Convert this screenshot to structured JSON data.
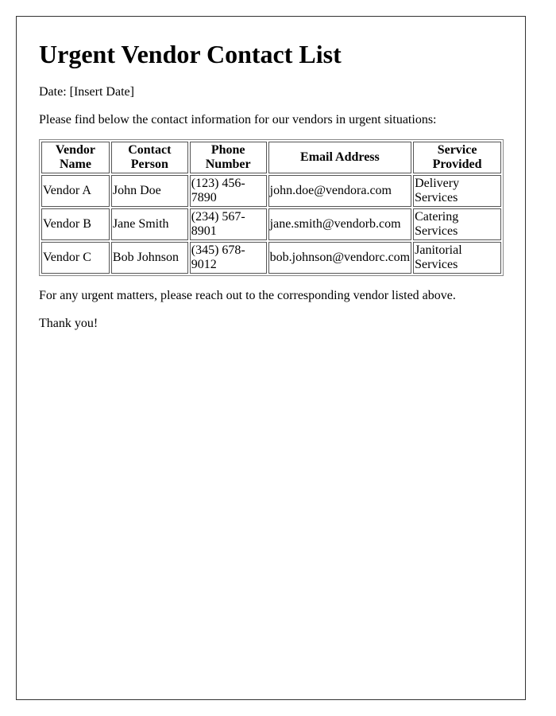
{
  "document": {
    "title": "Urgent Vendor Contact List",
    "date_line": "Date: [Insert Date]",
    "intro": "Please find below the contact information for our vendors in urgent situations:",
    "closing": "For any urgent matters, please reach out to the corresponding vendor listed above.",
    "thanks": "Thank you!"
  },
  "table": {
    "headers": [
      "Vendor Name",
      "Contact Person",
      "Phone Number",
      "Email Address",
      "Service Provided"
    ],
    "rows": [
      [
        "Vendor A",
        "John Doe",
        "(123) 456-7890",
        "john.doe@vendora.com",
        "Delivery Services"
      ],
      [
        "Vendor B",
        "Jane Smith",
        "(234) 567-8901",
        "jane.smith@vendorb.com",
        "Catering Services"
      ],
      [
        "Vendor C",
        "Bob Johnson",
        "(345) 678-9012",
        "bob.johnson@vendorc.com",
        "Janitorial Services"
      ]
    ]
  }
}
